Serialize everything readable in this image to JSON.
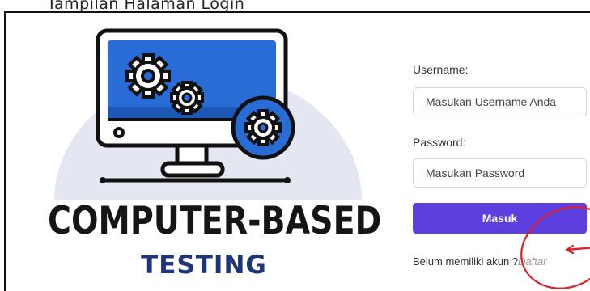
{
  "caption": {
    "text": "Tampilan Halaman Login"
  },
  "logo": {
    "title": "COMPUTER-BASED",
    "subtitle": "TESTING",
    "colors": {
      "ink": "#151515",
      "subtitle": "#1f3577",
      "screen": "#2a6cd6",
      "backdrop": "#e4e7f1"
    }
  },
  "login_form": {
    "username_label": "Username:",
    "username_placeholder": "Masukan Username Anda",
    "username_value": "",
    "password_label": "Password:",
    "password_placeholder": "Masukan Password",
    "password_value": "",
    "submit_label": "Masuk",
    "signup_prompt": "Belum memiliki akun ?",
    "signup_link": "Daftar",
    "colors": {
      "button": "#5d3fe0",
      "link": "#9a9a9a"
    }
  },
  "annotation": {
    "color": "#e0202a",
    "shape": "hand-drawn-circle-with-arrow"
  }
}
